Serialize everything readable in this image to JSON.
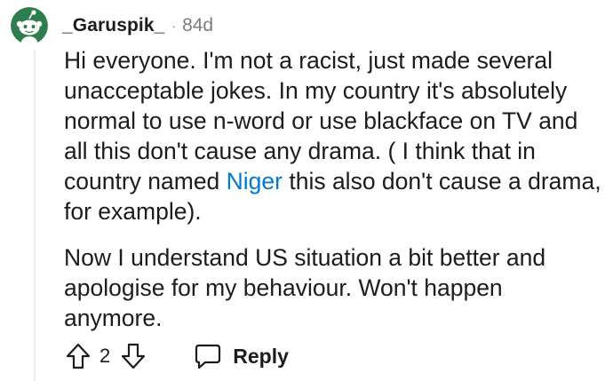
{
  "comment": {
    "author": "_Garuspik_",
    "separator": "·",
    "age": "84d",
    "paragraph1": {
      "before_link": "Hi everyone. I'm not a racist, just made several unacceptable jokes. In my country it's absolutely normal to use n-word or use blackface on TV and all this don't cause any drama. ( I think that in country named ",
      "link_text": "Niger",
      "after_link": " this also don't cause a drama, for example)."
    },
    "paragraph2": "Now I understand US situation a bit better and apologise for my behaviour. Won't happen anymore.",
    "score": "2",
    "reply_label": "Reply"
  },
  "colors": {
    "text": "#1c1c1c",
    "meta": "#7c7c7c",
    "link": "#0079d3",
    "thread_line": "#edeff1",
    "avatar_bg": "#2e7d4f"
  },
  "icons": {
    "avatar": "snoo-avatar",
    "upvote": "upvote-arrow-icon",
    "downvote": "downvote-arrow-icon",
    "reply": "speech-bubble-icon"
  }
}
